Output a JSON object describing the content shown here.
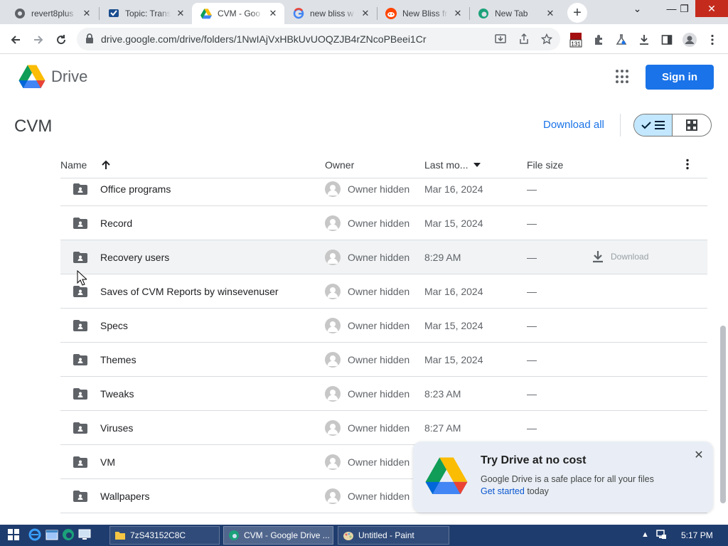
{
  "browser": {
    "tabs": [
      {
        "title": "revert8plus",
        "icon": "revert8plus-favicon"
      },
      {
        "title": "Topic: Trans",
        "icon": "forum-favicon"
      },
      {
        "title": "CVM - Goo",
        "icon": "google-drive-favicon",
        "active": true
      },
      {
        "title": "new bliss w",
        "icon": "google-favicon"
      },
      {
        "title": "New Bliss fr",
        "icon": "reddit-favicon"
      },
      {
        "title": "New Tab",
        "icon": "edge-favicon"
      }
    ],
    "new_tab_label": "+",
    "address": "drive.google.com/drive/folders/1NwIAjVxHBkUvUOQZJB4rZNcoPBeei1Cr",
    "extension_badge": "131"
  },
  "drive": {
    "brand": "Drive",
    "sign_in": "Sign in",
    "folder_title": "CVM",
    "download_all": "Download all"
  },
  "table": {
    "columns": {
      "name": "Name",
      "owner": "Owner",
      "last_modified": "Last mo...",
      "file_size": "File size"
    },
    "sort": "name-ascending",
    "download_label": "Download",
    "rows": [
      {
        "name": "Office programs",
        "owner": "Owner hidden",
        "modified": "Mar 16, 2024",
        "size": "—"
      },
      {
        "name": "Record",
        "owner": "Owner hidden",
        "modified": "Mar 15, 2024",
        "size": "—"
      },
      {
        "name": "Recovery users",
        "owner": "Owner hidden",
        "modified": "8:29 AM",
        "size": "—",
        "hover": true
      },
      {
        "name": "Saves of CVM Reports by winsevenuser",
        "owner": "Owner hidden",
        "modified": "Mar 16, 2024",
        "size": "—"
      },
      {
        "name": "Specs",
        "owner": "Owner hidden",
        "modified": "Mar 15, 2024",
        "size": "—"
      },
      {
        "name": "Themes",
        "owner": "Owner hidden",
        "modified": "Mar 15, 2024",
        "size": "—"
      },
      {
        "name": "Tweaks",
        "owner": "Owner hidden",
        "modified": "8:23 AM",
        "size": "—"
      },
      {
        "name": "Viruses",
        "owner": "Owner hidden",
        "modified": "8:27 AM",
        "size": "—"
      },
      {
        "name": "VM",
        "owner": "Owner hidden",
        "modified": "",
        "size": ""
      },
      {
        "name": "Wallpapers",
        "owner": "Owner hidden",
        "modified": "",
        "size": ""
      }
    ]
  },
  "promo": {
    "title": "Try Drive at no cost",
    "body": "Google Drive is a safe place for all your files",
    "link": "Get started",
    "suffix": " today"
  },
  "taskbar": {
    "items": [
      {
        "label": "7zS43152C8C",
        "icon": "folder-icon"
      },
      {
        "label": "CVM - Google Drive ...",
        "icon": "browser-icon",
        "active": true
      },
      {
        "label": "Untitled - Paint",
        "icon": "paint-icon"
      }
    ],
    "clock": "5:17 PM"
  },
  "colors": {
    "accent": "#1a73e8",
    "tabstrip": "#dee1e6",
    "taskbar": "#1f3c6e",
    "hover_row": "#f1f3f4",
    "promo_bg": "#e9eef6"
  }
}
